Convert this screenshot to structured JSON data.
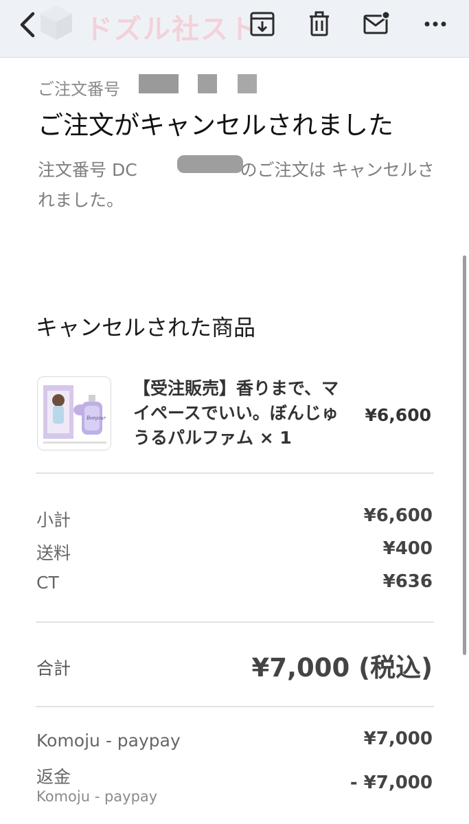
{
  "toolbar": {
    "back_icon": "chevron-left-icon",
    "brand_text": "ドズル社スト",
    "icons": [
      "archive-download-icon",
      "trash-icon",
      "mail-unread-icon",
      "more-icon"
    ]
  },
  "email": {
    "order_number_label": "ご注文番号",
    "headline": "ご注文がキャンセルされました",
    "message_prefix": "注文番号 DC",
    "message_suffix": "のご注文は キャンセルされました。"
  },
  "cancelled_items": {
    "title": "キャンセルされた商品",
    "items": [
      {
        "name": "【受注販売】香りまで、マイペースでいい。ぼんじゅうるパルファム × 1",
        "price": "¥6,600",
        "thumbnail_text": "Bonjour"
      }
    ]
  },
  "summary": {
    "rows": [
      {
        "label": "小計",
        "value": "¥6,600"
      },
      {
        "label": "送料",
        "value": "¥400"
      },
      {
        "label": "CT",
        "value": "¥636"
      }
    ],
    "total_label": "合計",
    "total_value": "¥7,000 (税込)"
  },
  "payments": [
    {
      "label": "Komoju - paypay",
      "value": "¥7,000"
    },
    {
      "label": "返金",
      "sublabel": "Komoju - paypay",
      "value": "- ¥7,000"
    }
  ],
  "colors": {
    "toolbar_bg": "#eef2f7",
    "icon": "#2b2b2b",
    "muted_text": "#7d7d7d",
    "divider": "#e2e2e2"
  }
}
